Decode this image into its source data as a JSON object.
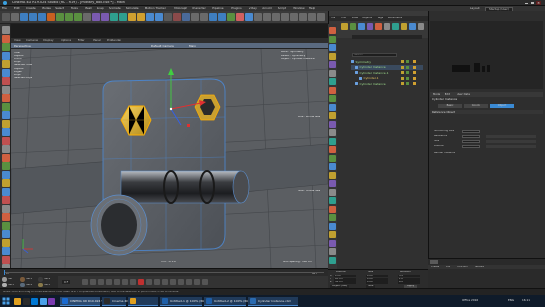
{
  "window": {
    "title": "CINEMA 4D R19.024 Studio (RC - R19) - [military_box.c4d *] - Main"
  },
  "menubar": {
    "items": [
      "File",
      "Edit",
      "Create",
      "Modes",
      "Select",
      "Tools",
      "Mesh",
      "Snap",
      "Animate",
      "Simulate",
      "Motion Tracker",
      "MoGraph",
      "Character",
      "Pipeline",
      "Plugins",
      "V-Ray",
      "Arnold",
      "Script",
      "Window",
      "Help"
    ]
  },
  "layout": {
    "label": "Layout:",
    "value": "Startup (User)"
  },
  "viewport": {
    "menu": [
      "View",
      "Cameras",
      "Display",
      "Options",
      "Filter",
      "Panel",
      "ProRender"
    ],
    "camera_label": "Default Camera",
    "camera_suffix": "Main",
    "perspective_label": "Perspective",
    "grid_spacing": "Grid Spacing : 100 cm",
    "fps": "FPS : 171.6",
    "stats_labels": [
      "Total",
      "Objects",
      "Points",
      "Polys"
    ],
    "stats_values": [
      "",
      "",
      "",
      ""
    ],
    "selected_title": "Selected Total",
    "sel_labels": [
      "Objects",
      "Edges",
      "Polys",
      "Selected Polys"
    ],
    "sel_values": [
      "",
      "",
      "",
      ""
    ],
    "bone_label": "Bone : Symmetry",
    "parent_label": "Parent : Symmetry",
    "object_label": "Object : Cylinder Instance",
    "axis_label": "Line : Whole Size",
    "side_label": "Side : Whole Size"
  },
  "object_manager": {
    "menu": [
      "File",
      "Edit",
      "View",
      "Objects",
      "Tags",
      "Bookmarks"
    ],
    "search_placeholder": "Search",
    "rows": [
      {
        "label": "Symmetry",
        "color": "#9edc8c"
      },
      {
        "label": "Cylinder Instance",
        "color": "#9edc8c"
      },
      {
        "label": "Cylinder Instance.1",
        "color": "#9edc8c"
      },
      {
        "label": "Cylinder.1",
        "color": "#e0c060"
      },
      {
        "label": "Cylinder Instance",
        "color": "#9edc8c"
      }
    ]
  },
  "attribute_manager": {
    "menu": [
      "Mode",
      "Edit",
      "User Data"
    ],
    "header": "Cylinder Instance",
    "tabs": [
      "Basic",
      "Coord.",
      "Object"
    ],
    "section": "Reference Object",
    "labels": [
      "Smoothing Axis",
      "Reference",
      "Size",
      "Position"
    ],
    "values": [
      "",
      "",
      "",
      ""
    ],
    "mode_label": "Render Instance"
  },
  "coordinates": {
    "headers": [
      "Position",
      "Size",
      "Rotation"
    ],
    "rows": [
      {
        "axis": "X",
        "pos": "0 cm",
        "size": "0 cm",
        "rot": "H 0°"
      },
      {
        "axis": "Y",
        "pos": "65 cm",
        "size": "0 cm",
        "rot": "P 0°"
      },
      {
        "axis": "Z",
        "pos": "54 cm",
        "size": "0 cm",
        "rot": "B 0°"
      }
    ],
    "object_btn": "Object (Rel)",
    "size_btn": "Size",
    "apply_btn": "Apply"
  },
  "timeline": {
    "frame_start": "0 F",
    "frame_end": "90 F",
    "current": "0 F"
  },
  "materials": {
    "menu": [
      "Create",
      "Edit",
      "Function",
      "Texture"
    ],
    "items": [
      "Mat",
      "Mat.1",
      "Mat.2",
      "Mat.3",
      "Mat.4",
      "Mat.5"
    ]
  },
  "status": {
    "text": "Move: Click and drag to move elements. Hold down SHIFT to quantize movement / add to the selection in point mode, CTRL to remove."
  },
  "taskbar": {
    "apps": [
      "CINEMA 4D R19.024 Studio",
      "Cinema 4D",
      "",
      "Untitled-1 @ 100% (RGB/8)",
      "Untitled-2 @ 100% (RGB/8)",
      "Cylinder Instance.c4d"
    ],
    "tray_text": "Office 2016",
    "lang": "ENG",
    "time": "16:11"
  },
  "colors": {
    "accent": "#3a8ad4",
    "viewport_bg": "#5e5e5e",
    "highlight": "#e8b830",
    "green_text": "#9edc8c"
  }
}
